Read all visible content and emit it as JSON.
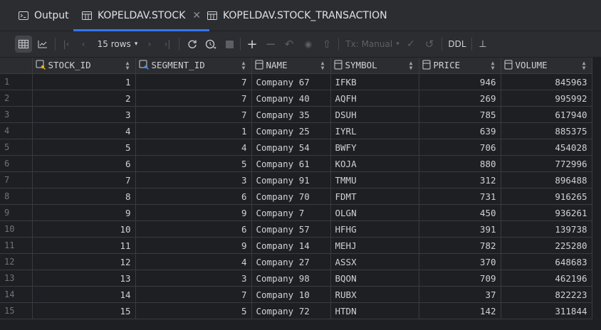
{
  "tabs": [
    {
      "label": "Output",
      "icon": "console-icon"
    },
    {
      "label": "KOPELDAV.STOCK",
      "icon": "table-icon",
      "closable": true
    },
    {
      "label": "KOPELDAV.STOCK_TRANSACTION",
      "icon": "table-icon"
    }
  ],
  "toolbar": {
    "rows_label": "15 rows",
    "tx_label": "Tx: Manual",
    "ddl_label": "DDL"
  },
  "columns": [
    "STOCK_ID",
    "SEGMENT_ID",
    "NAME",
    "SYMBOL",
    "PRICE",
    "VOLUME"
  ],
  "rows": [
    [
      "1",
      "1",
      "7",
      "Company 67",
      "IFKB",
      "946",
      "845963"
    ],
    [
      "2",
      "2",
      "7",
      "Company 40",
      "AQFH",
      "269",
      "995992"
    ],
    [
      "3",
      "3",
      "7",
      "Company 35",
      "DSUH",
      "785",
      "617940"
    ],
    [
      "4",
      "4",
      "1",
      "Company 25",
      "IYRL",
      "639",
      "885375"
    ],
    [
      "5",
      "5",
      "4",
      "Company 54",
      "BWFY",
      "706",
      "454028"
    ],
    [
      "6",
      "6",
      "5",
      "Company 61",
      "KOJA",
      "880",
      "772996"
    ],
    [
      "7",
      "7",
      "3",
      "Company 91",
      "TMMU",
      "312",
      "896488"
    ],
    [
      "8",
      "8",
      "6",
      "Company 70",
      "FDMT",
      "731",
      "916265"
    ],
    [
      "9",
      "9",
      "9",
      "Company 7",
      "OLGN",
      "450",
      "936261"
    ],
    [
      "10",
      "10",
      "6",
      "Company 57",
      "HFHG",
      "391",
      "139738"
    ],
    [
      "11",
      "11",
      "9",
      "Company 14",
      "MEHJ",
      "782",
      "225280"
    ],
    [
      "12",
      "12",
      "4",
      "Company 27",
      "ASSX",
      "370",
      "648683"
    ],
    [
      "13",
      "13",
      "3",
      "Company 98",
      "BQON",
      "709",
      "462196"
    ],
    [
      "14",
      "14",
      "7",
      "Company 10",
      "RUBX",
      "37",
      "822223"
    ],
    [
      "15",
      "15",
      "5",
      "Company 72",
      "HTDN",
      "142",
      "311844"
    ]
  ]
}
